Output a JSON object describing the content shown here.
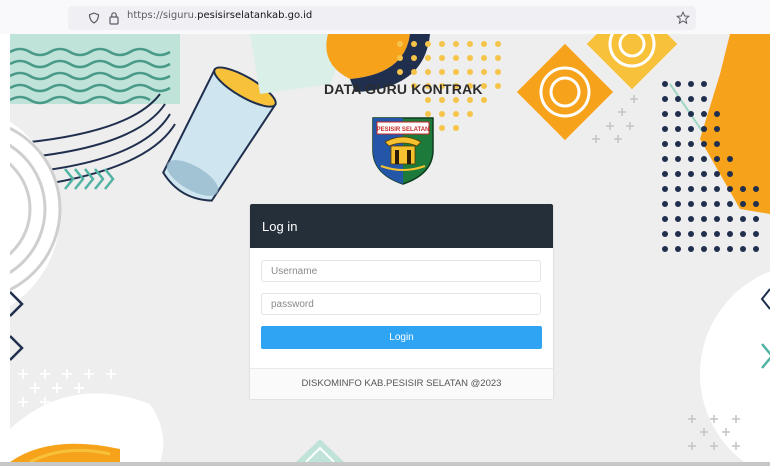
{
  "browser": {
    "url_prefix": "https://siguru.",
    "url_host": "pesisirselatankab.go.id"
  },
  "page": {
    "heading": "DATA GURU KONTRAK",
    "logo_text": "PESISIR SELATAN"
  },
  "login": {
    "title": "Log in",
    "username_placeholder": "Username",
    "password_placeholder": "password",
    "button_label": "Login",
    "footer": "DISKOMINFO KAB.PESISIR SELATAN @2023"
  },
  "colors": {
    "header_dark": "#242f3a",
    "button_blue": "#2fa4f2",
    "accent_orange": "#f7a21b",
    "accent_teal": "#bfe3d8",
    "accent_navy": "#1f2f4d"
  }
}
